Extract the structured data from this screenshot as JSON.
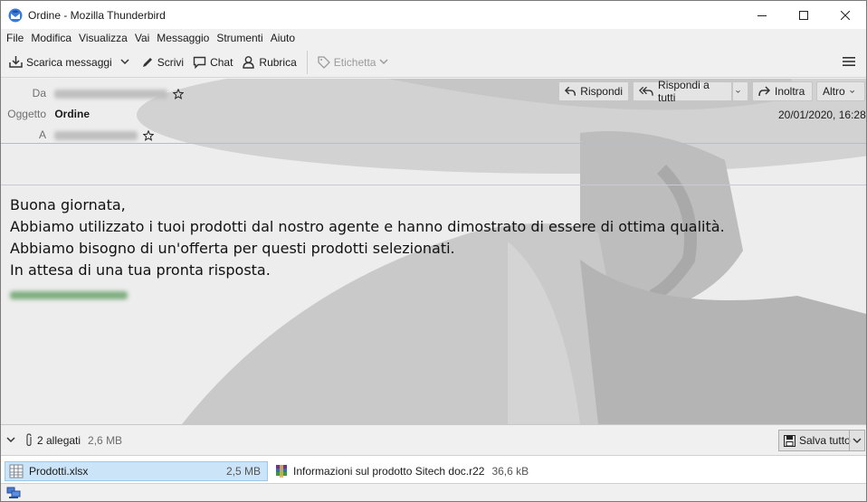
{
  "window": {
    "title": "Ordine - Mozilla Thunderbird"
  },
  "menubar": {
    "items": [
      "File",
      "Modifica",
      "Visualizza",
      "Vai",
      "Messaggio",
      "Strumenti",
      "Aiuto"
    ]
  },
  "toolbar": {
    "get_messages": "Scarica messaggi",
    "write": "Scrivi",
    "chat": "Chat",
    "address_book": "Rubrica",
    "tag": "Etichetta"
  },
  "header": {
    "from_label": "Da",
    "subject_label": "Oggetto",
    "subject": "Ordine",
    "to_label": "A",
    "date": "20/01/2020, 16:28",
    "reply": "Rispondi",
    "reply_all": "Rispondi a tutti",
    "forward": "Inoltra",
    "more": "Altro"
  },
  "message": {
    "lines": [
      "Buona giornata,",
      "Abbiamo utilizzato i tuoi prodotti dal nostro agente e hanno dimostrato di essere di ottima qualità.",
      "Abbiamo bisogno di un'offerta per questi prodotti selezionati.",
      "In attesa di una tua pronta risposta."
    ]
  },
  "attachments": {
    "count_label": "2 allegati",
    "total_size": "2,6 MB",
    "save_all": "Salva tutto",
    "items": [
      {
        "name": "Prodotti.xlsx",
        "size": "2,5 MB"
      },
      {
        "name": "Informazioni sul prodotto Sitech doc.r22",
        "size": "36,6 kB"
      }
    ]
  },
  "colors": {
    "selected_attachment": "#cce4f7",
    "signature_blur": "#7fae80"
  }
}
